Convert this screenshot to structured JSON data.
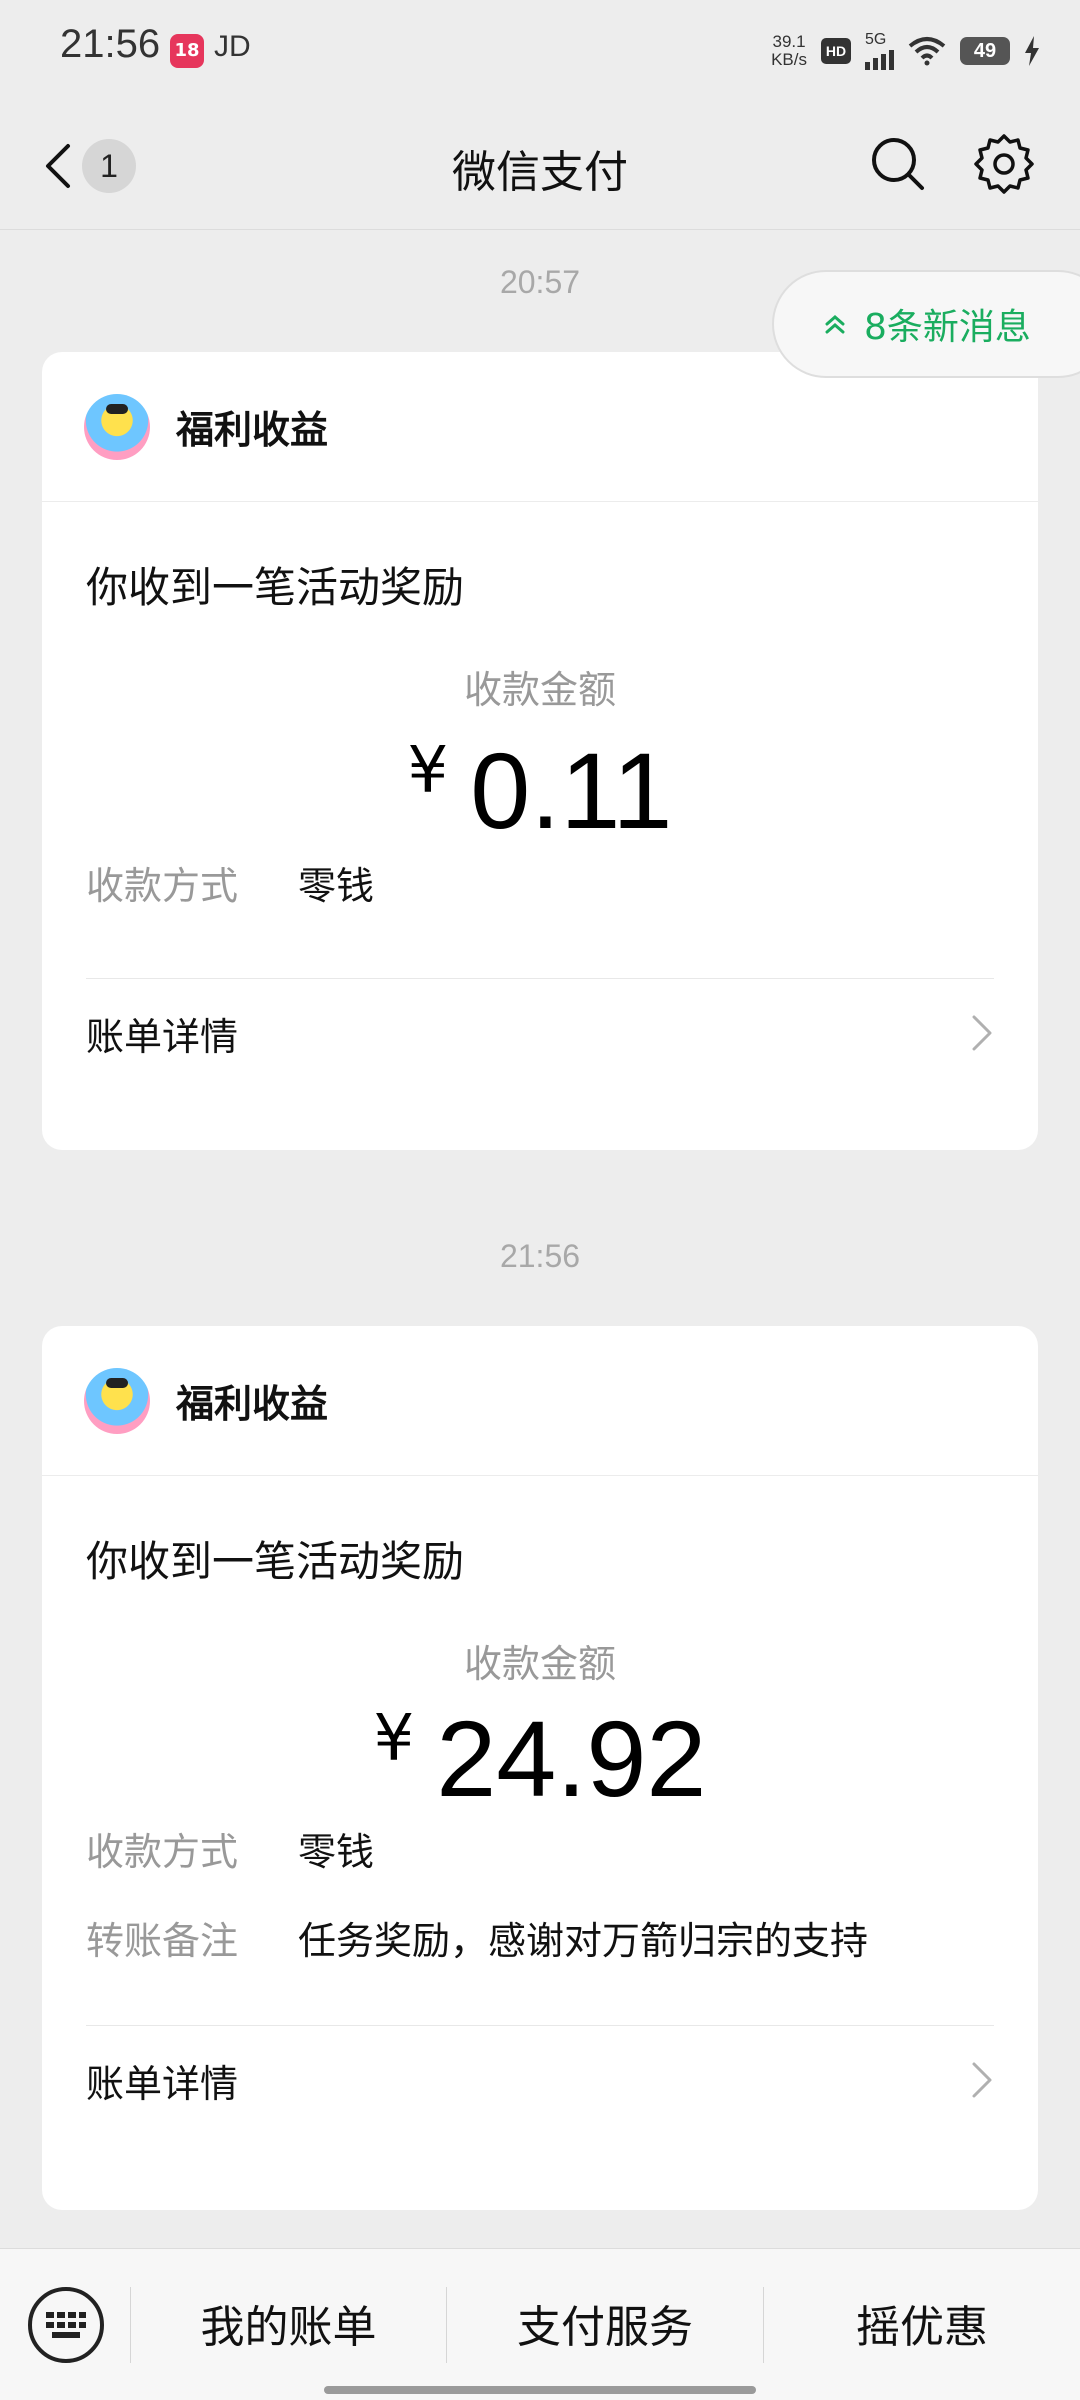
{
  "status_bar": {
    "time": "21:56",
    "app_badge": "18",
    "carrier_label": "JD",
    "net_speed_value": "39.1",
    "net_speed_unit": "KB/s",
    "hd_label": "HD",
    "network_label": "5G",
    "battery_level": "49"
  },
  "header": {
    "title": "微信支付",
    "unread_count": "1"
  },
  "new_messages": {
    "label": "8条新消息"
  },
  "messages": [
    {
      "timestamp": "20:57",
      "source": "福利收益",
      "headline": "你收到一笔活动奖励",
      "amount_label": "收款金额",
      "currency": "¥",
      "amount": "0.11",
      "method_label": "收款方式",
      "method_value": "零钱",
      "detail_label": "账单详情"
    },
    {
      "timestamp": "21:56",
      "source": "福利收益",
      "headline": "你收到一笔活动奖励",
      "amount_label": "收款金额",
      "currency": "¥",
      "amount": "24.92",
      "method_label": "收款方式",
      "method_value": "零钱",
      "note_label": "转账备注",
      "note_value": "任务奖励，感谢对万箭归宗的支持",
      "detail_label": "账单详情"
    }
  ],
  "bottom_menu": {
    "items": [
      "我的账单",
      "支付服务",
      "摇优惠"
    ]
  },
  "icons": {
    "back": "chevron-left-icon",
    "search": "search-icon",
    "settings": "gear-icon",
    "keyboard": "keyboard-icon",
    "chevron": "chevron-right-icon",
    "double_up": "double-chevron-up-icon"
  },
  "colors": {
    "accent_green": "#1aad5f",
    "background": "#ededed"
  }
}
